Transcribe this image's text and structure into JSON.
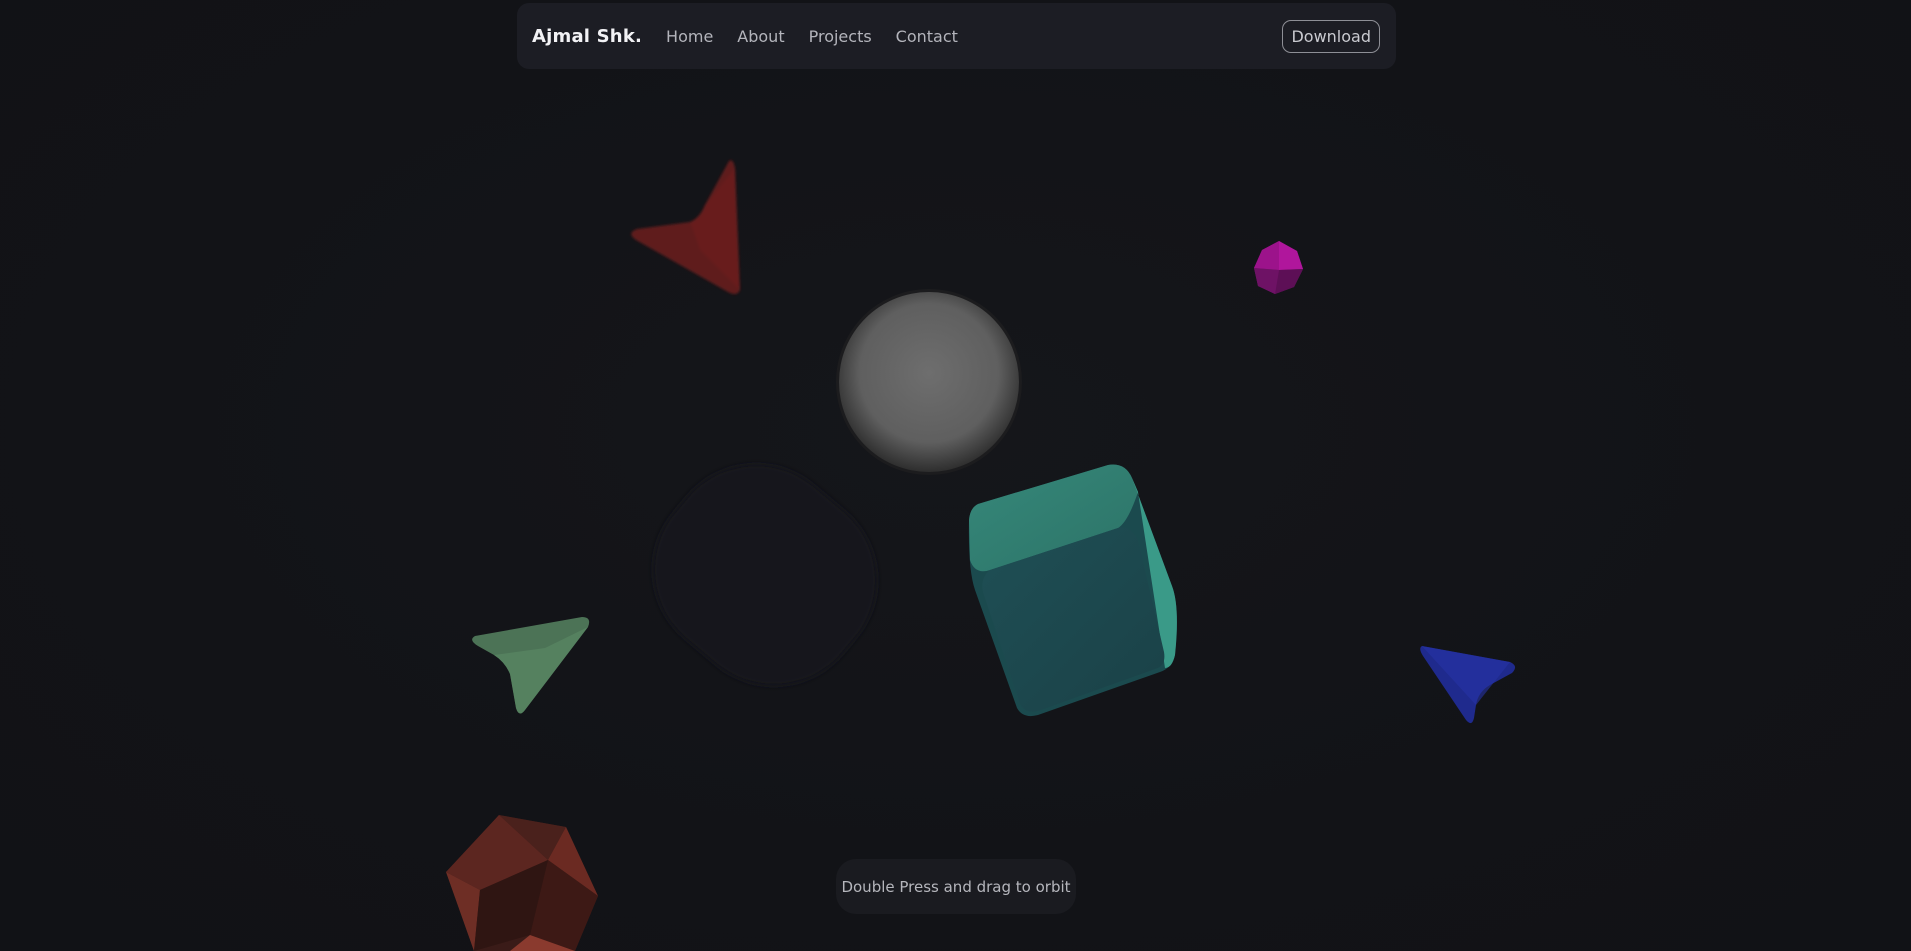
{
  "navbar": {
    "brand": "Ajmal Shk.",
    "links": [
      {
        "label": "Home"
      },
      {
        "label": "About"
      },
      {
        "label": "Projects"
      },
      {
        "label": "Contact"
      }
    ],
    "download_label": "Download"
  },
  "scene": {
    "shapes": [
      {
        "name": "red-cone-shape",
        "color": "#6b1f1f"
      },
      {
        "name": "magenta-octahedron-shape",
        "color": "#a0158e"
      },
      {
        "name": "gray-sphere-shape",
        "color": "#6e6e6e"
      },
      {
        "name": "dark-cylinder-shape",
        "color": "#16171a"
      },
      {
        "name": "teal-cube-shape",
        "color": "#2e8a79"
      },
      {
        "name": "green-cone-shape",
        "color": "#4f7a58"
      },
      {
        "name": "blue-cone-shape",
        "color": "#1e2a8c"
      },
      {
        "name": "red-icosahedron-shape",
        "color": "#7a2c24"
      }
    ]
  },
  "hint": {
    "text": "Double Press and drag to orbit"
  }
}
